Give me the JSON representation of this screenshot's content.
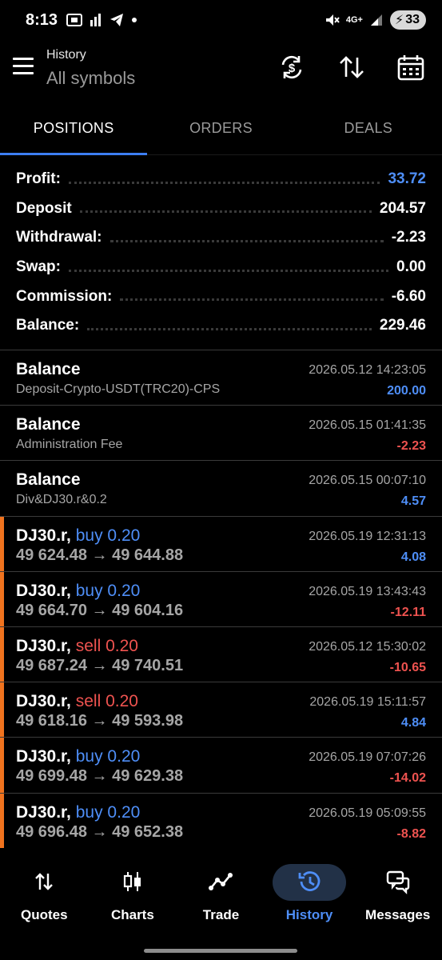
{
  "status_bar": {
    "time": "8:13",
    "battery": "33",
    "network": "4G+"
  },
  "header": {
    "title": "History",
    "subtitle": "All symbols"
  },
  "tabs": [
    {
      "label": "POSITIONS",
      "active": true
    },
    {
      "label": "ORDERS",
      "active": false
    },
    {
      "label": "DEALS",
      "active": false
    }
  ],
  "summary": [
    {
      "label": "Profit:",
      "value": "33.72",
      "color": "#4e8ef7"
    },
    {
      "label": "Deposit",
      "value": "204.57"
    },
    {
      "label": "Withdrawal:",
      "value": "-2.23"
    },
    {
      "label": "Swap:",
      "value": "0.00"
    },
    {
      "label": "Commission:",
      "value": "-6.60"
    },
    {
      "label": "Balance:",
      "value": "229.46"
    }
  ],
  "balances": [
    {
      "title": "Balance",
      "comment": "Deposit-Crypto-USDT(TRC20)-CPS",
      "date": "2026.05.12 14:23:05",
      "amount": "200.00",
      "sign": "positive"
    },
    {
      "title": "Balance",
      "comment": "Administration Fee",
      "date": "2026.05.15 01:41:35",
      "amount": "-2.23",
      "sign": "negative"
    },
    {
      "title": "Balance",
      "comment": "Div&DJ30.r&0.2",
      "date": "2026.05.15 00:07:10",
      "amount": "4.57",
      "sign": "positive"
    }
  ],
  "positions": [
    {
      "symbol": "DJ30.r,",
      "side": "buy 0.20",
      "prices": "49 624.48 → 49 644.88",
      "date": "2026.05.19 12:31:13",
      "amount": "4.08",
      "sign": "positive"
    },
    {
      "symbol": "DJ30.r,",
      "side": "buy 0.20",
      "prices": "49 664.70 → 49 604.16",
      "date": "2026.05.19 13:43:43",
      "amount": "-12.11",
      "sign": "negative"
    },
    {
      "symbol": "DJ30.r,",
      "side": "sell 0.20",
      "prices": "49 687.24 → 49 740.51",
      "date": "2026.05.12 15:30:02",
      "amount": "-10.65",
      "sign": "negative"
    },
    {
      "symbol": "DJ30.r,",
      "side": "sell 0.20",
      "prices": "49 618.16 → 49 593.98",
      "date": "2026.05.19 15:11:57",
      "amount": "4.84",
      "sign": "positive"
    },
    {
      "symbol": "DJ30.r,",
      "side": "buy 0.20",
      "prices": "49 699.48 → 49 629.38",
      "date": "2026.05.19 07:07:26",
      "amount": "-14.02",
      "sign": "negative"
    },
    {
      "symbol": "DJ30.r,",
      "side": "buy 0.20",
      "prices": "49 696.48 → 49 652.38",
      "date": "2026.05.19 05:09:55",
      "amount": "-8.82",
      "sign": "negative"
    }
  ],
  "bottom_nav": [
    {
      "label": "Quotes",
      "icon": "quotes-arrows-icon"
    },
    {
      "label": "Charts",
      "icon": "candlestick-icon"
    },
    {
      "label": "Trade",
      "icon": "trade-line-icon"
    },
    {
      "label": "History",
      "icon": "history-clock-icon",
      "active": true
    },
    {
      "label": "Messages",
      "icon": "chat-bubbles-icon"
    }
  ],
  "colors": {
    "accent": "#4e8ef7",
    "negative": "#ef5350",
    "position_bar": "#f0731e"
  }
}
